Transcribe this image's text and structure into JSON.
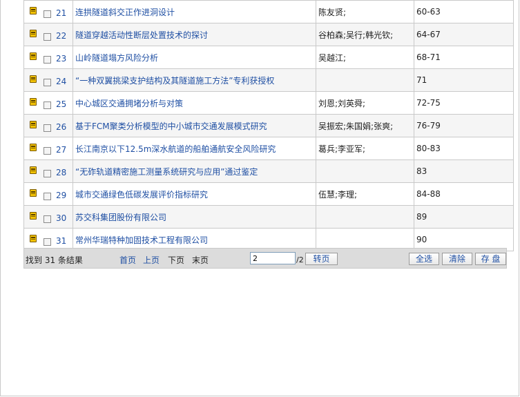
{
  "rows": [
    {
      "num": "21",
      "title": "连拱隧道斜交正作进洞设计",
      "author": "陈友贤;",
      "pages": "60-63"
    },
    {
      "num": "22",
      "title": "隧道穿越活动性断层处置技术的探讨",
      "author": "谷柏森;吴行;韩光钦;",
      "pages": "64-67"
    },
    {
      "num": "23",
      "title": "山岭隧道塌方风险分析",
      "author": "吴越江;",
      "pages": "68-71"
    },
    {
      "num": "24",
      "title": "“一种双翼挑梁支护结构及其隧道施工方法”专利获授权",
      "author": "",
      "pages": "71"
    },
    {
      "num": "25",
      "title": "中心城区交通拥堵分析与对策",
      "author": "刘恩;刘英舜;",
      "pages": "72-75"
    },
    {
      "num": "26",
      "title": "基于FCM聚类分析模型的中小城市交通发展模式研究",
      "author": "吴振宏;朱国娟;张爽;",
      "pages": "76-79"
    },
    {
      "num": "27",
      "title": "长江南京以下12.5m深水航道的船舶通航安全风险研究",
      "author": "葛兵;李亚军;",
      "pages": "80-83"
    },
    {
      "num": "28",
      "title": "“无砟轨道精密施工测量系统研究与应用”通过鉴定",
      "author": "",
      "pages": "83"
    },
    {
      "num": "29",
      "title": "城市交通绿色低碳发展评价指标研究",
      "author": "伍慧;李理;",
      "pages": "84-88"
    },
    {
      "num": "30",
      "title": "苏交科集团股份有限公司",
      "author": "",
      "pages": "89"
    },
    {
      "num": "31",
      "title": "常州华瑞特种加固技术工程有限公司",
      "author": "",
      "pages": "90"
    }
  ],
  "pager": {
    "found": "找到 31 条结果",
    "first": "首页",
    "prev": "上页",
    "next": "下页",
    "last": "末页",
    "page_value": "2",
    "total": "/2",
    "go_label": "转页",
    "select_all": "全选",
    "clear": "清除",
    "save": "存 盘"
  }
}
